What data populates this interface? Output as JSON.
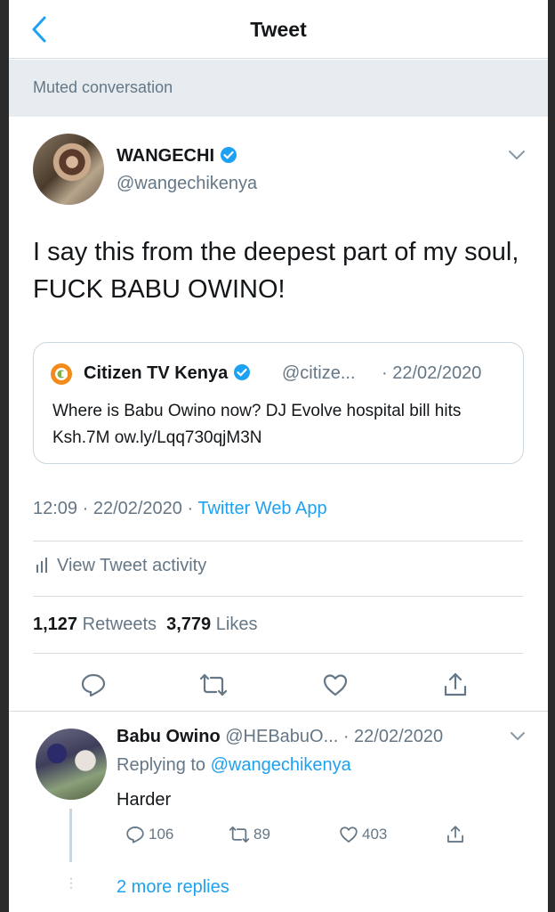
{
  "header": {
    "title": "Tweet"
  },
  "banner": {
    "text": "Muted conversation"
  },
  "tweet": {
    "author_name": "WANGECHI",
    "author_handle": "@wangechikenya",
    "text": "I say this from the deepest part of my soul, FUCK BABU OWINO!",
    "quote": {
      "name": "Citizen TV Kenya",
      "handle": "@citize...",
      "date": "· 22/02/2020",
      "text": "Where is Babu Owino now? DJ Evolve hospital bill hits Ksh.7M ow.ly/Lqq730qjM3N"
    },
    "time": "12:09 · 22/02/2020 · ",
    "source": "Twitter Web App",
    "activity_label": "View Tweet activity",
    "retweets_count": "1,127",
    "retweets_label": "Retweets",
    "likes_count": "3,779",
    "likes_label": "Likes"
  },
  "reply": {
    "name": "Babu Owino",
    "handle_date": "@HEBabuO... · 22/02/2020",
    "replying_prefix": "Replying to ",
    "replying_handle": "@wangechikenya",
    "text": "Harder",
    "reply_count": "106",
    "retweet_count": "89",
    "like_count": "403",
    "more_replies": "2 more replies"
  },
  "colors": {
    "accent": "#1da1f2",
    "muted": "#657786",
    "border": "#d8dde1"
  }
}
